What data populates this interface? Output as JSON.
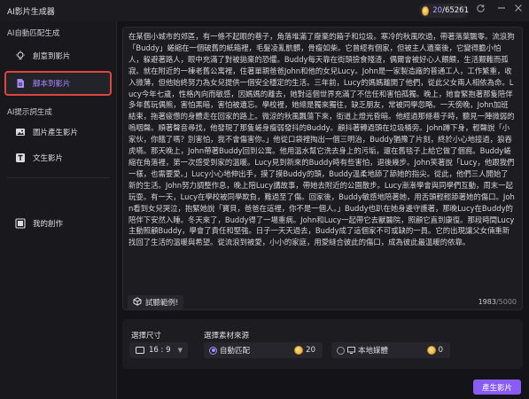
{
  "app": {
    "title": "AI影片生成器"
  },
  "credits": {
    "current": "20",
    "total": "/65261"
  },
  "sidebar": {
    "section1_title": "AI自動匹配生成",
    "items1": [
      {
        "label": "創意到影片",
        "icon": "lightbulb-icon"
      },
      {
        "label": "腳本到影片",
        "icon": "document-icon"
      }
    ],
    "section2_title": "AI提示詞生成",
    "items2": [
      {
        "label": "圖片產生影片",
        "icon": "image-icon"
      },
      {
        "label": "文生影片",
        "icon": "text-icon"
      }
    ],
    "items3": [
      {
        "label": "我的創作",
        "icon": "folder-icon"
      }
    ]
  },
  "editor": {
    "text": "在某個小城市的郊區，有一條不起眼的巷子，角落堆滿了廢棄的箱子和垃圾。寒冷的秋風吹過，帶著落葉飄零。流浪狗「Buddy」蜷縮在一個破舊的紙箱裡，毛髮凌亂骯髒，骨瘦如柴。它曾經有個家，但被主人遺棄後，它變得膽小怕人，躲避著路人，眼中充滿了對被拋棄的恐懼。Buddy每天靠在街頭撿食殘渣，偶爾會被好心人餵餵，生活艱難而孤寂。就在附近的一棟老舊公寓裡，住著單親爸爸John和他的女兒Lucy。John是一家製造廠的普通工人，工作繁重，收入微薄，但他始終努力為女兒提供一個安全穩定的生活。三年前，Lucy的媽媽離開了他們，從此父女兩人相依為命。Lucy今年七歲，性格內向而敏感，因媽媽的離去，她對這個世界充滿了不信任和害怕孤獨。晚上，她會緊抱著那隻陪伴多年舊玩偶熊，害怕黑暗，害怕被遺忘。學校裡，她總是獨來獨往，缺乏朋友，常被同學忽略。一天傍晚，John加班結束，拖著疲憊的身體走在回家的路上。微涼的秋風飄蕩下來，街道上燈光昏暗。他經過那條巷子時，聽見一陣微弱的嗚咽聲。順著聲音尋找，他發現了那隻蜷身瘦弱發抖的Buddy。顧抖著轉過頭在垃圾桶旁。John蹲下身，輕聲說「小家伙，你餓了嗎？別害怕，我不會傷害你。」他從口袋裡掏出一個三明治，Buddy猶豫了片刻，終於小心地接過，狼吞虎嚥。那天晚上，John帶著Buddy回到公寓。他用溫水幫它洗去身上的污垢，還在舊毯子上給它做了個窩。Buddy蜷縮在角落裡，第一次感受到家的溫暖。Lucy見到新來的Buddy時有些害怕，退後幾步。John笑著說「Lucy，他跟我們一樣，也需要愛。」Lucy小心地伸出手，摸了摸Buddy的頭，Buddy溫柔地舔了舔她的指尖。從此，他們三人開始了新的生活。John努力調整作息，晚上陪Lucy講故事，帶她去附近的公園散步。Lucy漸漸學會與同學們互動，周末一起玩耍。有一天，Lucy在學校被同學欺負，難過至了傷。回家後，Buddy敏感地陪著她，用舌頭輕輕舔著她的傷口。John看到女兒哭泣，抱緊她說「寶貝，爸爸在這裡，你不是一個人。」Buddy也趴在她身邊守護著，那晚Lucy在Buddy的陪伴下安然入睡。冬天來了，Buddy得了一場重病。John和Lucy一起帶它去獸醫院，照顧它直到康復。那段時間Lucy主動照顧Buddy，學會了責任和堅強。日子一天天過去，Buddy成了這個家不可或缺的一員。它的出現讓父女倆重新找回了生活的溫暖與希望。從流浪到被愛，小小的家庭，用愛縫合彼此的傷口，成為彼此最溫暖的依靠。",
    "example_button": "試聽範例!",
    "count": "1983",
    "max": "/5000"
  },
  "options": {
    "ratio_label": "選擇尺寸",
    "ratio_value": "16 : 9",
    "source_label": "選擇素材來源",
    "sources": [
      {
        "label": "自動匹配",
        "cost": "20",
        "selected": true
      },
      {
        "label": "本地媒體",
        "cost": "0",
        "selected": false
      }
    ]
  },
  "generate_button": "產生影片",
  "colors": {
    "accent": "#8a5cf6",
    "highlight_border": "#e0443f",
    "background": "#141418"
  }
}
